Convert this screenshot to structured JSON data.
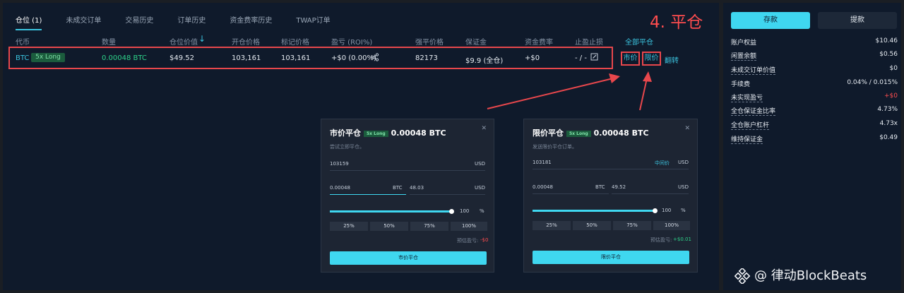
{
  "tabs": [
    "仓位 (1)",
    "未成交订单",
    "交易历史",
    "订单历史",
    "资金费率历史",
    "TWAP订单"
  ],
  "step_label": "4. 平仓",
  "table": {
    "headers": [
      "代币",
      "数量",
      "仓位价值",
      "开仓价格",
      "标记价格",
      "盈亏 (ROI%)",
      "强平价格",
      "保证金",
      "资金费率",
      "止盈止损"
    ],
    "close_all": "全部平仓",
    "row": {
      "coin": "BTC",
      "leverage": "5x Long",
      "size": "0.00048 BTC",
      "value": "$49.52",
      "entry": "103,161",
      "mark": "103,161",
      "pnl": "+$0 (0.00%)",
      "liq": "82173",
      "margin": "$9.9 (全仓)",
      "funding": "+$0",
      "tpsl": "- / -",
      "market": "市价",
      "limit": "限价",
      "reverse": "翻转"
    }
  },
  "market_modal": {
    "title": "市价平仓",
    "badge": "5x Long",
    "amount": "0.00048 BTC",
    "subtitle": "尝试立即平仓。",
    "price": "103159",
    "price_unit": "USD",
    "qty": "0.00048",
    "qty_unit": "BTC",
    "qty_usd": "48.03",
    "usd": "USD",
    "slider_value": "100",
    "slider_unit": "%",
    "pcts": [
      "25%",
      "50%",
      "75%",
      "100%"
    ],
    "est_label": "预估盈亏:",
    "est_value": "-$0",
    "button": "市价平仓"
  },
  "limit_modal": {
    "title": "限价平仓",
    "badge": "5x Long",
    "amount": "0.00048 BTC",
    "subtitle": "发送限价平仓订单。",
    "price": "103181",
    "mid": "中间价",
    "price_unit": "USD",
    "qty": "0.00048",
    "qty_unit": "BTC",
    "qty_usd": "49.52",
    "usd": "USD",
    "slider_value": "100",
    "slider_unit": "%",
    "pcts": [
      "25%",
      "50%",
      "75%",
      "100%"
    ],
    "est_label": "预估盈亏:",
    "est_value": "+$0.01",
    "button": "限价平仓"
  },
  "sidebar": {
    "deposit": "存款",
    "withdraw": "提款",
    "rows": [
      {
        "label": "账户权益",
        "value": "$10.46"
      },
      {
        "label": "闲置余额",
        "value": "$0.56"
      },
      {
        "label": "未成交订单价值",
        "value": "$0"
      },
      {
        "label": "手续费",
        "value": "0.04% / 0.015%"
      },
      {
        "label": "未实现盈亏",
        "value": "+$0"
      },
      {
        "label": "全仓保证金比率",
        "value": "4.73%"
      },
      {
        "label": "全仓账户杠杆",
        "value": "4.73x"
      },
      {
        "label": "维持保证金",
        "value": "$0.49"
      }
    ]
  },
  "watermark": "@ 律动BlockBeats",
  "colors": {
    "accent": "#3bc3de",
    "green": "#2ed38a",
    "red": "#ff4d4f",
    "bg": "#0f1a2b"
  }
}
